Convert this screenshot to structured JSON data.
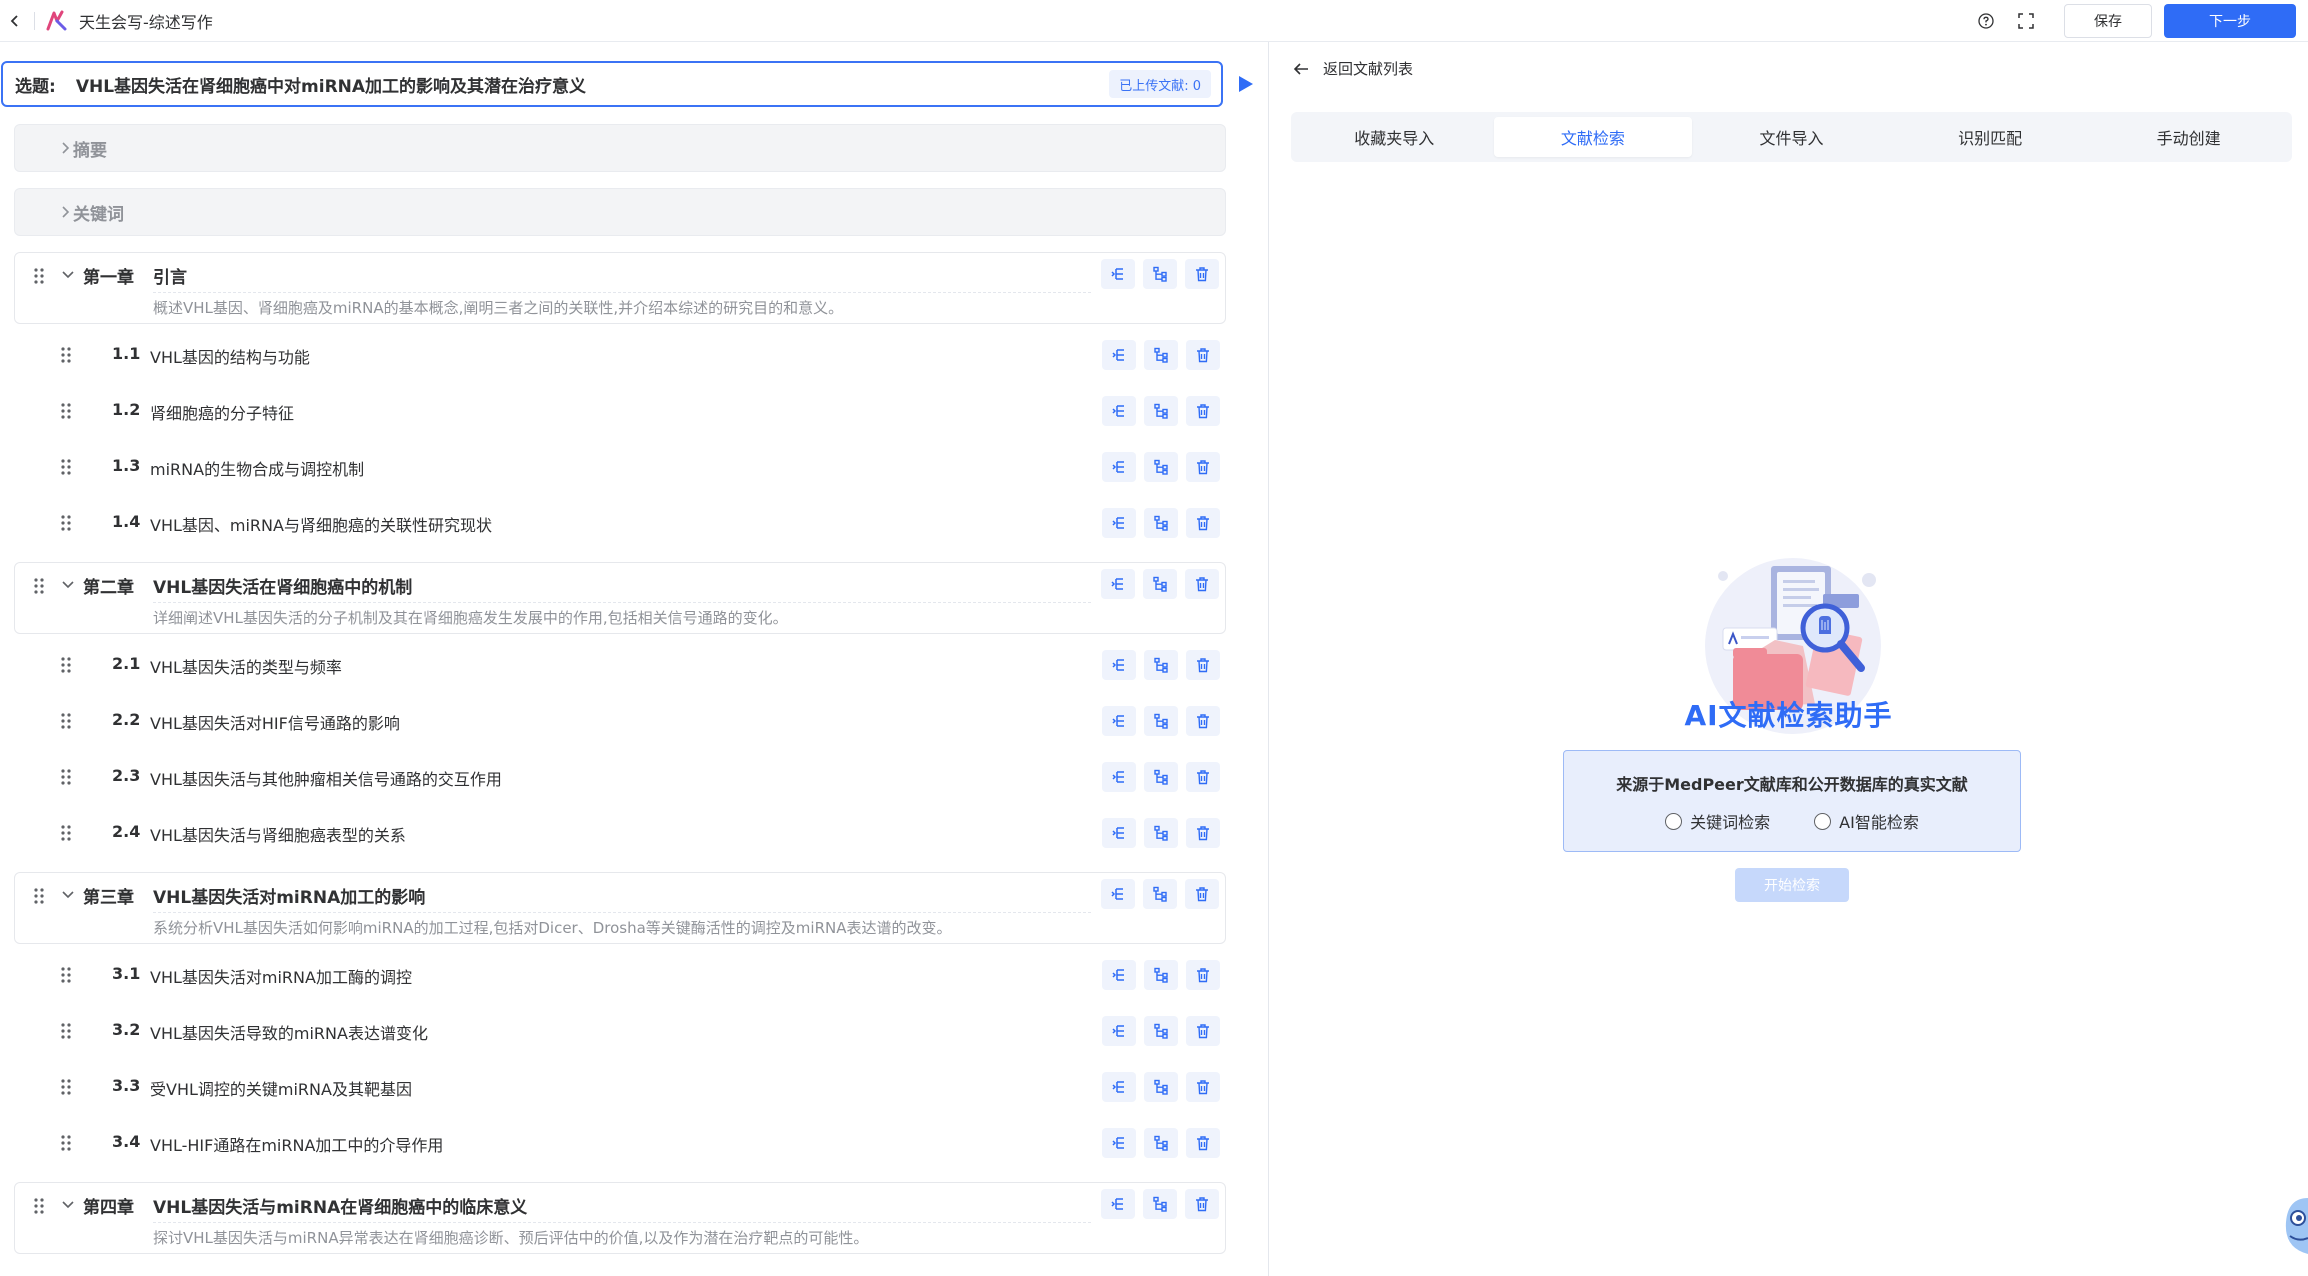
{
  "app": {
    "title": "天生会写-综述写作",
    "save_label": "保存",
    "next_label": "下一步"
  },
  "topic": {
    "label": "选题:",
    "text": "VHL基因失活在肾细胞癌中对miRNA加工的影响及其潜在治疗意义",
    "badge": "已上传文献: 0"
  },
  "sections": {
    "abstract_label": "摘要",
    "keywords_label": "关键词"
  },
  "outline": {
    "chapters": [
      {
        "no": "第一章",
        "title": "引言",
        "desc": "概述VHL基因、肾细胞癌及miRNA的基本概念,阐明三者之间的关联性,并介绍本综述的研究目的和意义。",
        "sections": [
          {
            "no": "1.1",
            "title": "VHL基因的结构与功能"
          },
          {
            "no": "1.2",
            "title": "肾细胞癌的分子特征"
          },
          {
            "no": "1.3",
            "title": "miRNA的生物合成与调控机制"
          },
          {
            "no": "1.4",
            "title": "VHL基因、miRNA与肾细胞癌的关联性研究现状"
          }
        ]
      },
      {
        "no": "第二章",
        "title": "VHL基因失活在肾细胞癌中的机制",
        "desc": "详细阐述VHL基因失活的分子机制及其在肾细胞癌发生发展中的作用,包括相关信号通路的变化。",
        "sections": [
          {
            "no": "2.1",
            "title": "VHL基因失活的类型与频率"
          },
          {
            "no": "2.2",
            "title": "VHL基因失活对HIF信号通路的影响"
          },
          {
            "no": "2.3",
            "title": "VHL基因失活与其他肿瘤相关信号通路的交互作用"
          },
          {
            "no": "2.4",
            "title": "VHL基因失活与肾细胞癌表型的关系"
          }
        ]
      },
      {
        "no": "第三章",
        "title": "VHL基因失活对miRNA加工的影响",
        "desc": "系统分析VHL基因失活如何影响miRNA的加工过程,包括对Dicer、Drosha等关键酶活性的调控及miRNA表达谱的改变。",
        "sections": [
          {
            "no": "3.1",
            "title": "VHL基因失活对miRNA加工酶的调控"
          },
          {
            "no": "3.2",
            "title": "VHL基因失活导致的miRNA表达谱变化"
          },
          {
            "no": "3.3",
            "title": "受VHL调控的关键miRNA及其靶基因"
          },
          {
            "no": "3.4",
            "title": "VHL-HIF通路在miRNA加工中的介导作用"
          }
        ]
      },
      {
        "no": "第四章",
        "title": "VHL基因失活与miRNA在肾细胞癌中的临床意义",
        "desc": "探讨VHL基因失活与miRNA异常表达在肾细胞癌诊断、预后评估中的价值,以及作为潜在治疗靶点的可能性。",
        "sections": []
      }
    ]
  },
  "right": {
    "return_label": "返回文献列表",
    "tabs": [
      {
        "label": "收藏夹导入"
      },
      {
        "label": "文献检索"
      },
      {
        "label": "文件导入"
      },
      {
        "label": "识别匹配"
      },
      {
        "label": "手动创建"
      }
    ],
    "active_tab": "文献检索",
    "assistant_title": "AI文献检索助手",
    "source_text": "来源于MedPeer文献库和公开数据库的真实文献",
    "radio_keyword": "关键词检索",
    "radio_ai": "AI智能检索",
    "start_label": "开始检索"
  },
  "colors": {
    "primary": "#2f6cf6",
    "border_active": "#3b73f5",
    "muted_text": "#909399"
  },
  "icons": {
    "back": "chevron-left-icon",
    "help": "question-circle-icon",
    "fullscreen": "fullscreen-icon",
    "drag": "drag-handle-icon",
    "action_insert": "insert-section-icon",
    "action_tree": "tree-structure-icon",
    "action_delete": "trash-icon"
  }
}
